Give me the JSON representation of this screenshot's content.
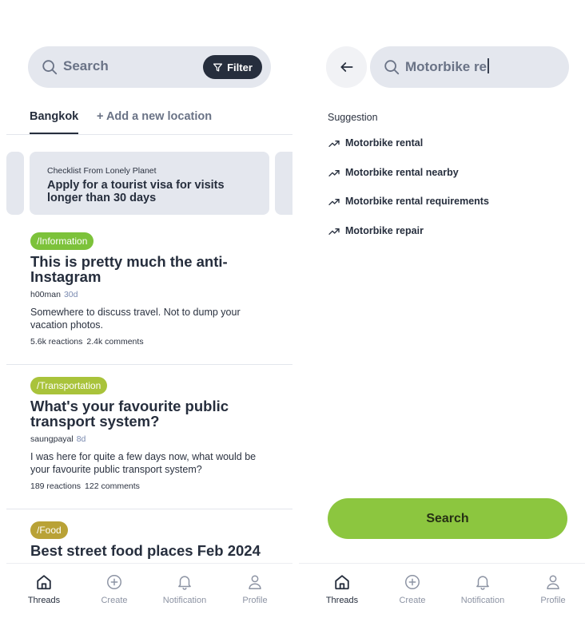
{
  "colors": {
    "accent_green": "#8cc63f",
    "tag_information": "#7cc23a",
    "tag_transportation": "#a9c33b",
    "tag_food": "#b9a236",
    "dark": "#262e3d",
    "surface": "#e4e7ee"
  },
  "left": {
    "search": {
      "placeholder": "Search",
      "filter_label": "Filter",
      "search_icon": "search-icon",
      "filter_icon": "filter-icon"
    },
    "locations": {
      "active": "Bangkok",
      "add": "+ Add a new location"
    },
    "featured": {
      "subtitle": "Checklist From Lonely Planet",
      "title": "Apply for a tourist visa for visits longer than 30 days"
    },
    "posts": [
      {
        "tag": "/Information",
        "title": "This is pretty much the anti-Instagram",
        "author": "h00man",
        "time": "30d",
        "body": "Somewhere to discuss travel. Not to dump your vacation photos.",
        "reactions": "5.6k reactions",
        "comments": "2.4k comments"
      },
      {
        "tag": "/Transportation",
        "title": "What's your favourite public transport system?",
        "author": "saungpayal",
        "time": "8d",
        "body": "I was here for quite a few days now, what would be your favourite public transport system?",
        "reactions": "189 reactions",
        "comments": "122 comments"
      },
      {
        "tag": "/Food",
        "title": "Best street food places Feb 2024"
      }
    ]
  },
  "right": {
    "search": {
      "value": "Motorbike re",
      "back_icon": "arrow-left-icon",
      "search_icon": "search-icon"
    },
    "suggestion_title": "Suggestion",
    "suggestion_icon": "trending-up-icon",
    "suggestions": [
      "Motorbike rental",
      "Motorbike rental nearby",
      "Motorbike rental requirements",
      "Motorbike repair"
    ],
    "search_button": "Search"
  },
  "nav": {
    "items": [
      {
        "label": "Threads",
        "icon": "home-icon",
        "active": true
      },
      {
        "label": "Create",
        "icon": "plus-circle-icon",
        "active": false
      },
      {
        "label": "Notification",
        "icon": "bell-icon",
        "active": false
      },
      {
        "label": "Profile",
        "icon": "user-icon",
        "active": false
      }
    ]
  }
}
